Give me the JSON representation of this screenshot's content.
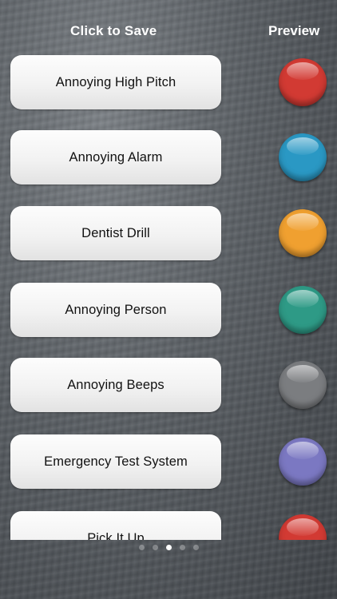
{
  "header": {
    "save_title": "Click to Save",
    "preview_title": "Preview"
  },
  "sounds": [
    {
      "label": "Annoying High Pitch",
      "color": "#d23a33"
    },
    {
      "label": "Annoying Alarm",
      "color": "#2a98c4"
    },
    {
      "label": "Dentist Drill",
      "color": "#f0a030"
    },
    {
      "label": "Annoying Person",
      "color": "#2e9a86"
    },
    {
      "label": "Annoying Beeps",
      "color": "#7b7d80"
    },
    {
      "label": "Emergency Test System",
      "color": "#7b78c2"
    },
    {
      "label": "Pick It Up",
      "color": "#d23a33"
    }
  ],
  "pagination": {
    "page_count": 5,
    "current_page": 3
  }
}
